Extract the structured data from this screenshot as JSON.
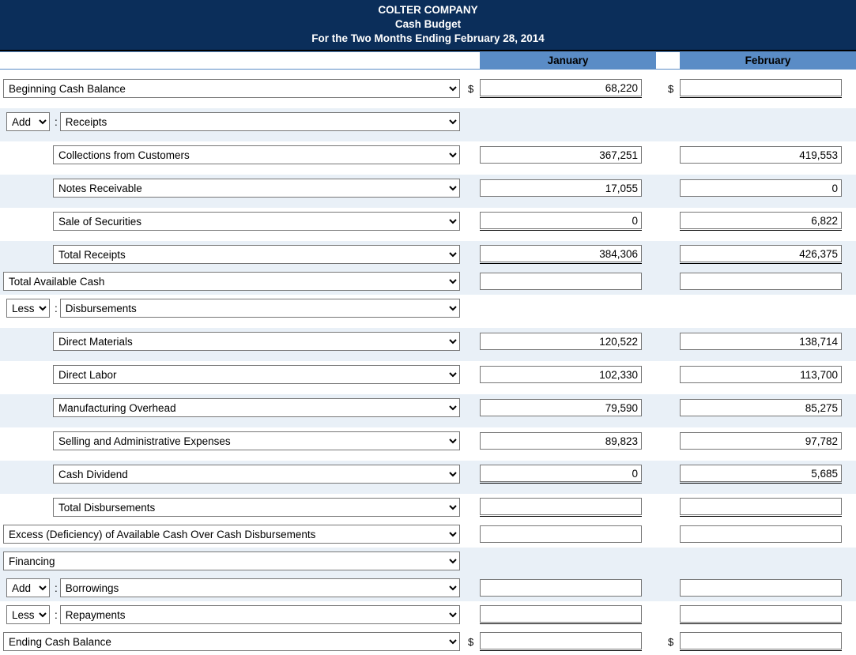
{
  "header": {
    "company": "COLTER COMPANY",
    "title": "Cash Budget",
    "period": "For the Two Months Ending February 28, 2014"
  },
  "months": {
    "jan": "January",
    "feb": "February"
  },
  "ops": {
    "add": "Add",
    "less": "Less"
  },
  "lines": {
    "beginning": "Beginning Cash Balance",
    "receipts": "Receipts",
    "collections": "Collections from Customers",
    "notes": "Notes Receivable",
    "sale_sec": "Sale of Securities",
    "total_receipts": "Total Receipts",
    "total_avail": "Total Available Cash",
    "disbursements": "Disbursements",
    "dm": "Direct Materials",
    "dl": "Direct Labor",
    "moh": "Manufacturing Overhead",
    "sga": "Selling and Administrative Expenses",
    "div": "Cash Dividend",
    "total_disb": "Total Disbursements",
    "excess": "Excess (Deficiency) of Available Cash Over Cash Disbursements",
    "financing": "Financing",
    "borrowings": "Borrowings",
    "repayments": "Repayments",
    "ending": "Ending Cash Balance"
  },
  "values": {
    "beginning": {
      "jan": "68,220",
      "feb": ""
    },
    "collections": {
      "jan": "367,251",
      "feb": "419,553"
    },
    "notes": {
      "jan": "17,055",
      "feb": "0"
    },
    "sale_sec": {
      "jan": "0",
      "feb": "6,822"
    },
    "total_receipts": {
      "jan": "384,306",
      "feb": "426,375"
    },
    "total_avail": {
      "jan": "",
      "feb": ""
    },
    "dm": {
      "jan": "120,522",
      "feb": "138,714"
    },
    "dl": {
      "jan": "102,330",
      "feb": "113,700"
    },
    "moh": {
      "jan": "79,590",
      "feb": "85,275"
    },
    "sga": {
      "jan": "89,823",
      "feb": "97,782"
    },
    "div": {
      "jan": "0",
      "feb": "5,685"
    },
    "total_disb": {
      "jan": "",
      "feb": ""
    },
    "excess": {
      "jan": "",
      "feb": ""
    },
    "borrowings": {
      "jan": "",
      "feb": ""
    },
    "repayments": {
      "jan": "",
      "feb": ""
    },
    "ending": {
      "jan": "",
      "feb": ""
    }
  },
  "dollar": "$"
}
